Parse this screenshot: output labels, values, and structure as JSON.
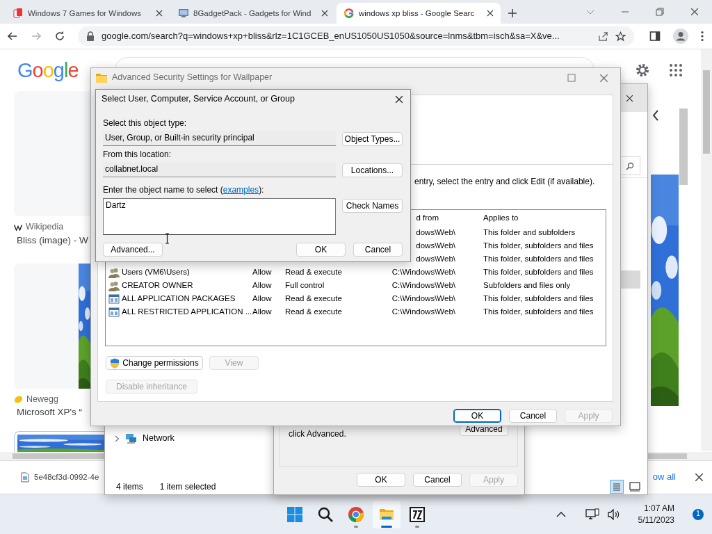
{
  "browser": {
    "tabs": [
      {
        "title": "Windows 7 Games for Windows",
        "kind": "cards",
        "selected": false
      },
      {
        "title": "8GadgetPack - Gadgets for Wind",
        "kind": "monitor",
        "selected": false
      },
      {
        "title": "windows xp bliss - Google Searc",
        "kind": "google",
        "selected": true
      }
    ],
    "url": "google.com/search?q=windows+xp+bliss&rlz=1C1GCEB_enUS1050US1050&source=lnms&tbm=isch&sa=X&ve..."
  },
  "google_page": {
    "logo": "Google",
    "results": [
      {
        "source": "Wikipedia",
        "kind": "wikipedia",
        "title": "Bliss (image) - W"
      },
      {
        "source": "Newegg",
        "kind": "newegg",
        "title": "Microsoft XP's “"
      }
    ]
  },
  "download_bar": {
    "file": "5e48cf3d-0992-4e",
    "show_all": "ow all"
  },
  "explorer": {
    "nav_items": [
      {
        "label": "Network"
      }
    ],
    "item_count": "4 items",
    "selection": "1 item selected"
  },
  "properties_dialog": {
    "note": "click Advanced.",
    "side_button": "Advanced",
    "buttons": [
      {
        "label": "OK",
        "disabled": false
      },
      {
        "label": "Cancel",
        "disabled": false
      },
      {
        "label": "Apply",
        "disabled": true
      }
    ]
  },
  "advanced_security": {
    "title": "Advanced Security Settings for Wallpaper",
    "instruction": "entry, select the entry and click Edit (if available).",
    "columns": [
      "d from",
      "Applies to"
    ],
    "rows": [
      {
        "inherited_from": "dows\\Web\\",
        "applies_to": "This folder and subfolders"
      },
      {
        "inherited_from": "dows\\Web\\",
        "applies_to": "This folder, subfolders and files"
      },
      {
        "inherited_from": "dows\\Web\\",
        "applies_to": "This folder, subfolders and files"
      },
      {
        "kind": "group",
        "principal": "Users (VM6\\Users)",
        "type": "Allow",
        "access": "Read & execute",
        "inherited_from": "C:\\Windows\\Web\\",
        "applies_to": "This folder, subfolders and files"
      },
      {
        "kind": "group",
        "principal": "CREATOR OWNER",
        "type": "Allow",
        "access": "Full control",
        "inherited_from": "C:\\Windows\\Web\\",
        "applies_to": "Subfolders and files only"
      },
      {
        "kind": "package",
        "principal": "ALL APPLICATION PACKAGES",
        "type": "Allow",
        "access": "Read & execute",
        "inherited_from": "C:\\Windows\\Web\\",
        "applies_to": "This folder, subfolders and files"
      },
      {
        "kind": "package",
        "principal": "ALL RESTRICTED APPLICATION ...",
        "type": "Allow",
        "access": "Read & execute",
        "inherited_from": "C:\\Windows\\Web\\",
        "applies_to": "This folder, subfolders and files"
      }
    ],
    "actions": [
      {
        "label": "Change permissions",
        "kind": "shield",
        "disabled": false
      },
      {
        "label": "View",
        "kind": "plain",
        "disabled": true
      },
      {
        "label": "Disable inheritance",
        "kind": "plain",
        "disabled": true
      }
    ],
    "buttons": [
      {
        "label": "OK",
        "default": true,
        "disabled": false
      },
      {
        "label": "Cancel",
        "default": false,
        "disabled": false
      },
      {
        "label": "Apply",
        "default": false,
        "disabled": true
      }
    ]
  },
  "select_dialog": {
    "title": "Select User, Computer, Service Account, or Group",
    "object_type_label": "Select this object type:",
    "object_type": "User, Group, or Built-in security principal",
    "object_types_button": "Object Types...",
    "location_label": "From this location:",
    "location": "collabnet.local",
    "locations_button": "Locations...",
    "name_label_before": "Enter the object name to select (",
    "name_link": "examples",
    "name_label_after": "):",
    "object_name": "Dartz",
    "check_names_button": "Check Names",
    "buttons": [
      {
        "label": "Advanced..."
      },
      {
        "label": "OK"
      },
      {
        "label": "Cancel"
      }
    ]
  },
  "taskbar": {
    "apps": [
      {
        "kind": "start",
        "running": false,
        "active": false
      },
      {
        "kind": "search",
        "running": false,
        "active": false
      },
      {
        "kind": "chrome",
        "running": true,
        "active": false
      },
      {
        "kind": "explorer",
        "running": true,
        "active": true
      },
      {
        "kind": "sevenzip",
        "running": true,
        "active": false
      }
    ],
    "time": "1:07 AM",
    "date": "5/11/2023",
    "notification_count": "1"
  }
}
